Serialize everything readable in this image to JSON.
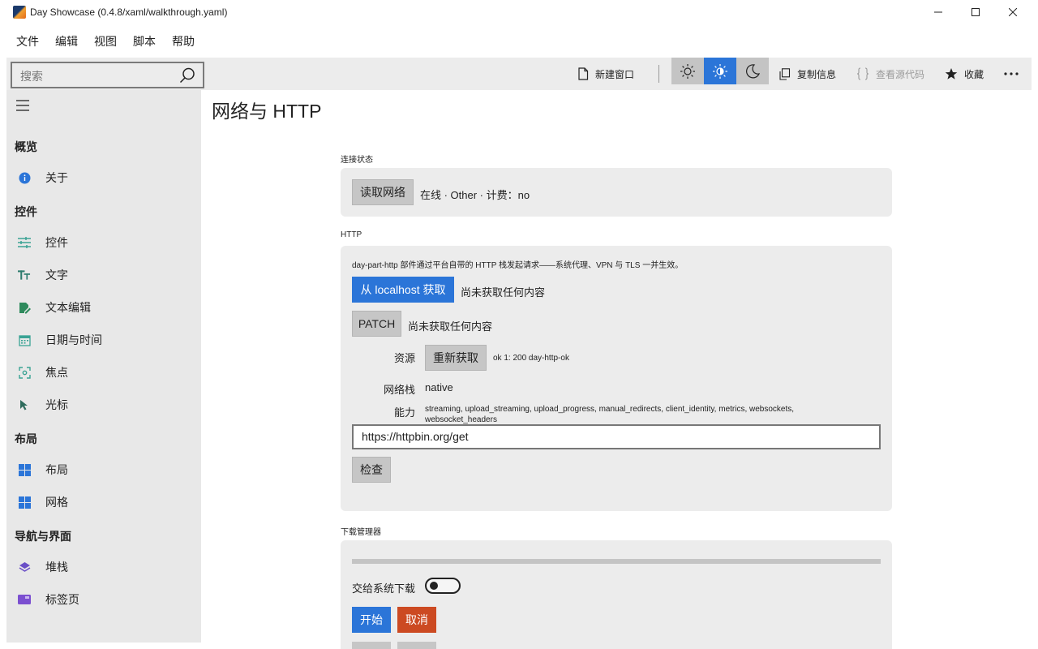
{
  "window": {
    "title": "Day Showcase (0.4.8/xaml/walkthrough.yaml)"
  },
  "menu": [
    "文件",
    "编辑",
    "视图",
    "脚本",
    "帮助"
  ],
  "toolbar": {
    "search_placeholder": "搜索",
    "new_window": "新建窗口",
    "copy_info": "复制信息",
    "view_source": "查看源代码",
    "favorite": "收藏"
  },
  "sidebar": {
    "sections": [
      {
        "title": "概览",
        "items": [
          {
            "label": "关于",
            "icon": "info-icon"
          }
        ]
      },
      {
        "title": "控件",
        "items": [
          {
            "label": "控件",
            "icon": "sliders-icon"
          },
          {
            "label": "文字",
            "icon": "text-icon"
          },
          {
            "label": "文本编辑",
            "icon": "edit-icon"
          },
          {
            "label": "日期与时间",
            "icon": "calendar-icon"
          },
          {
            "label": "焦点",
            "icon": "focus-icon"
          },
          {
            "label": "光标",
            "icon": "cursor-icon"
          }
        ]
      },
      {
        "title": "布局",
        "items": [
          {
            "label": "布局",
            "icon": "layout-icon"
          },
          {
            "label": "网格",
            "icon": "grid-icon"
          }
        ]
      },
      {
        "title": "导航与界面",
        "items": [
          {
            "label": "堆栈",
            "icon": "stack-icon"
          },
          {
            "label": "标签页",
            "icon": "tabs-icon"
          }
        ]
      }
    ]
  },
  "main": {
    "title": "网络与 HTTP",
    "connection": {
      "label": "连接状态",
      "read_button": "读取网络",
      "status": "在线 · Other · 计费：no"
    },
    "http": {
      "label": "HTTP",
      "description": "day-part-http 部件通过平台自带的 HTTP 栈发起请求——系统代理、VPN 与 TLS 一并生效。",
      "fetch_button": "从 localhost 获取",
      "fetch_status": "尚未获取任何内容",
      "patch_button": "PATCH",
      "patch_status": "尚未获取任何内容",
      "resource_label": "资源",
      "refetch_button": "重新获取",
      "resource_value": "ok 1: 200 day-http-ok",
      "stack_label": "网络栈",
      "stack_value": "native",
      "capability_label": "能力",
      "capability_line1": "streaming, upload_streaming, upload_progress, manual_redirects, client_identity, metrics, websockets,",
      "capability_line2": "websocket_headers",
      "url_value": "https://httpbin.org/get",
      "inspect_button": "检查"
    },
    "downloads": {
      "label": "下载管理器",
      "progress": 0,
      "handoff_label": "交给系统下载",
      "handoff_on": false,
      "start_button": "开始",
      "cancel_button": "取消"
    }
  },
  "colors": {
    "accent": "#2b75d8",
    "danger": "#cc4a22",
    "sidebar_bg": "#e8e8e8",
    "card_bg": "#ececec"
  }
}
